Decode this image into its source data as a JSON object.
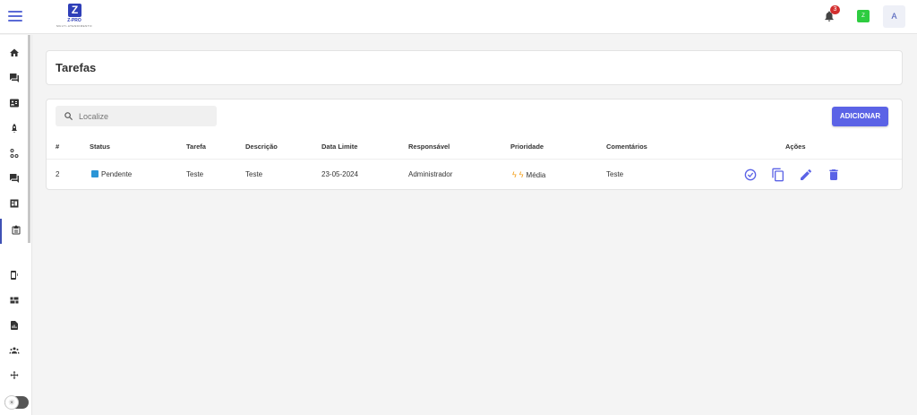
{
  "header": {
    "logo_name": "Z-PRO",
    "logo_sub": "MULTI-ATENDIMENTO",
    "notifications_count": "3",
    "status_label": "Z",
    "avatar_initial": "A"
  },
  "sidebar": {
    "items": [
      {
        "icon": "home-icon"
      },
      {
        "icon": "chat-icon"
      },
      {
        "icon": "contact-card-icon"
      },
      {
        "icon": "rocket-icon"
      },
      {
        "icon": "flow-icon"
      },
      {
        "icon": "message-icon"
      },
      {
        "icon": "dashboard-icon"
      },
      {
        "icon": "clipboard-icon",
        "active": true
      },
      {
        "icon": "mobile-connection-icon"
      },
      {
        "icon": "grid-icon"
      },
      {
        "icon": "report-icon"
      },
      {
        "icon": "group-icon"
      },
      {
        "icon": "network-icon"
      }
    ],
    "theme_toggle_symbol": "☀"
  },
  "page": {
    "title": "Tarefas"
  },
  "search": {
    "placeholder": "Localize"
  },
  "add_button_label": "ADICIONAR",
  "table": {
    "columns": [
      "#",
      "Status",
      "Tarefa",
      "Descrição",
      "Data Limite",
      "Responsável",
      "Prioridade",
      "Comentários",
      "Ações"
    ],
    "rows": [
      {
        "id": "2",
        "status": "Pendente",
        "task": "Teste",
        "description": "Teste",
        "due_date": "23-05-2024",
        "assignee": "Administrador",
        "priority": "Média",
        "comments": "Teste"
      }
    ],
    "actions": [
      "check-circle-icon",
      "copy-icon",
      "edit-icon",
      "delete-icon"
    ]
  },
  "colors": {
    "accent": "#5b63e6",
    "status_pending": "#2b95d6",
    "priority_bolt": "#f39c12",
    "notification_badge": "#d32f2f",
    "online": "#2ecc40"
  }
}
